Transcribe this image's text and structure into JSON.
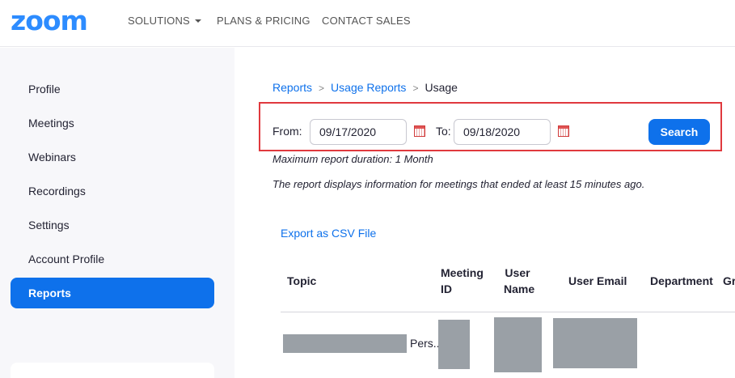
{
  "header": {
    "logo": "zoom",
    "nav": [
      "SOLUTIONS",
      "PLANS & PRICING",
      "CONTACT SALES"
    ]
  },
  "sidebar": {
    "items": [
      {
        "label": "Profile"
      },
      {
        "label": "Meetings"
      },
      {
        "label": "Webinars"
      },
      {
        "label": "Recordings"
      },
      {
        "label": "Settings"
      },
      {
        "label": "Account Profile"
      },
      {
        "label": "Reports",
        "active": true
      }
    ]
  },
  "breadcrumb": {
    "items": [
      "Reports",
      "Usage Reports",
      "Usage"
    ],
    "separator": ">"
  },
  "filter": {
    "from_label": "From:",
    "from_value": "09/17/2020",
    "to_label": "To:",
    "to_value": "09/18/2020",
    "search_label": "Search"
  },
  "notes": {
    "max_duration": "Maximum report duration: 1 Month",
    "info": "The report displays information for meetings that ended at least 15 minutes ago."
  },
  "export": {
    "label": "Export as CSV File"
  },
  "table": {
    "columns": {
      "topic": "Topic",
      "meeting_id_1": "Meeting",
      "meeting_id_2": "ID",
      "user_name_1": "User",
      "user_name_2": "Name",
      "user_email": "User Email",
      "department": "Department",
      "group": "Gr"
    },
    "rows": [
      {
        "topic_suffix": "Pers..."
      }
    ]
  },
  "colors": {
    "brand": "#2d8cff",
    "accent": "#0e71eb",
    "highlight": "#e0393e"
  }
}
